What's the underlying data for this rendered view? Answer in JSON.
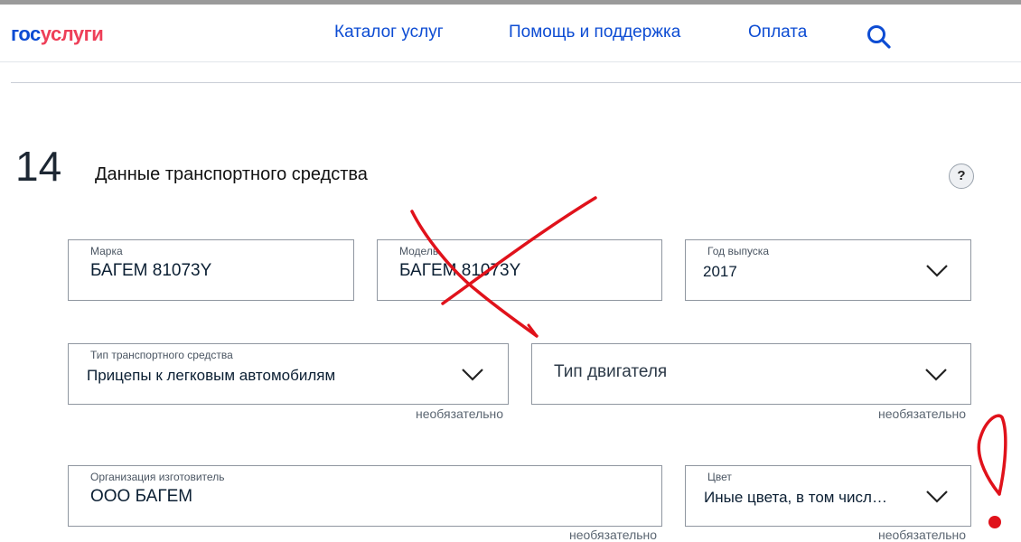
{
  "header": {
    "logo_gos": "гос",
    "logo_uslugi": "услуги",
    "nav": [
      "Каталог услуг",
      "Помощь и поддержка",
      "Оплата"
    ]
  },
  "section": {
    "number": "14",
    "title": "Данные транспортного средства",
    "help": "?"
  },
  "fields": {
    "brand": {
      "label": "Марка",
      "value": "БАГЕМ 81073Y"
    },
    "model": {
      "label": "Модель",
      "value": "БАГЕМ 81073Y"
    },
    "year": {
      "label": "Год выпуска",
      "value": "2017"
    },
    "vehicle_type": {
      "label": "Тип транспортного средства",
      "value": "Прицепы к легковым автомобилям",
      "hint": "необязательно"
    },
    "engine_type": {
      "placeholder": "Тип двигателя",
      "hint": "необязательно"
    },
    "manufacturer": {
      "label": "Организация изготовитель",
      "value": "ООО БАГЕМ",
      "hint": "необязательно"
    },
    "color": {
      "label": "Цвет",
      "value": "Иные цвета, в том числ…",
      "hint": "необязательно"
    }
  },
  "annotation_color": "#e0121b",
  "accent_color": "#0d4cd3"
}
